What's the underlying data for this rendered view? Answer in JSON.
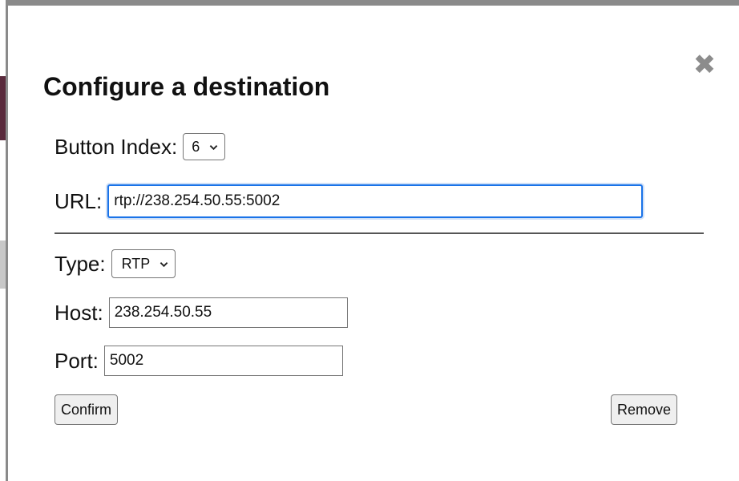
{
  "dialog": {
    "title": "Configure a destination",
    "close_glyph": "✖",
    "button_index": {
      "label": "Button Index:",
      "value": "6"
    },
    "url": {
      "label": "URL:",
      "value": "rtp://238.254.50.55:5002"
    },
    "type": {
      "label": "Type:",
      "value": "RTP"
    },
    "host": {
      "label": "Host:",
      "value": "238.254.50.55"
    },
    "port": {
      "label": "Port:",
      "value": "5002"
    },
    "confirm_label": "Confirm",
    "remove_label": "Remove"
  },
  "colors": {
    "focus_border": "#1a73e8",
    "close_icon": "#8c8c8c"
  },
  "icons": {
    "close": "close-icon",
    "dropdown": "chevron-down-icon"
  }
}
